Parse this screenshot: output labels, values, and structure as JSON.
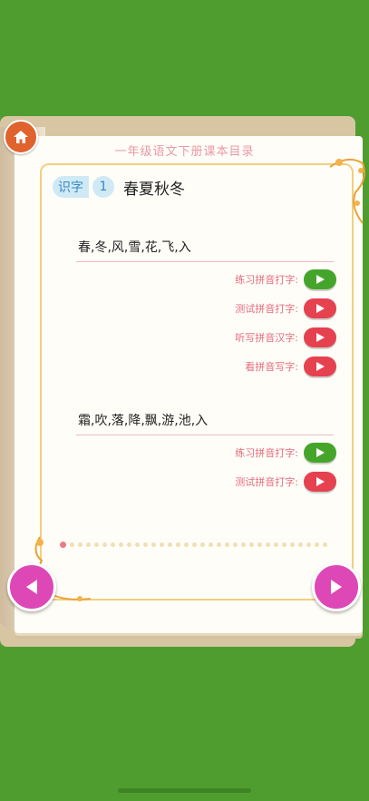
{
  "page": {
    "title": "一年级语文下册课本目录"
  },
  "header": {
    "tag": "识字",
    "number": "1",
    "lesson_title": "春夏秋冬"
  },
  "sections": [
    {
      "chars": "春,冬,风,雪,花,飞,入",
      "actions": [
        {
          "label": "练习拼音打字:",
          "button_color": "green"
        },
        {
          "label": "测试拼音打字:",
          "button_color": "red"
        },
        {
          "label": "听写拼音汉字:",
          "button_color": "red"
        },
        {
          "label": "看拼音写字:",
          "button_color": "red"
        }
      ]
    },
    {
      "chars": "霜,吹,落,降,飘,游,池,入",
      "actions": [
        {
          "label": "练习拼音打字:",
          "button_color": "green"
        },
        {
          "label": "测试拼音打字:",
          "button_color": "red"
        }
      ]
    }
  ],
  "pagination": {
    "current_page": 1
  },
  "icons": {
    "home": "home-icon",
    "prev": "left-arrow-icon",
    "next": "right-arrow-icon",
    "play": "play-icon"
  },
  "colors": {
    "background": "#4f9d2f",
    "play_green": "#45a52a",
    "play_red": "#e5414f",
    "nav": "#de47b6",
    "label": "#e36d7d"
  }
}
